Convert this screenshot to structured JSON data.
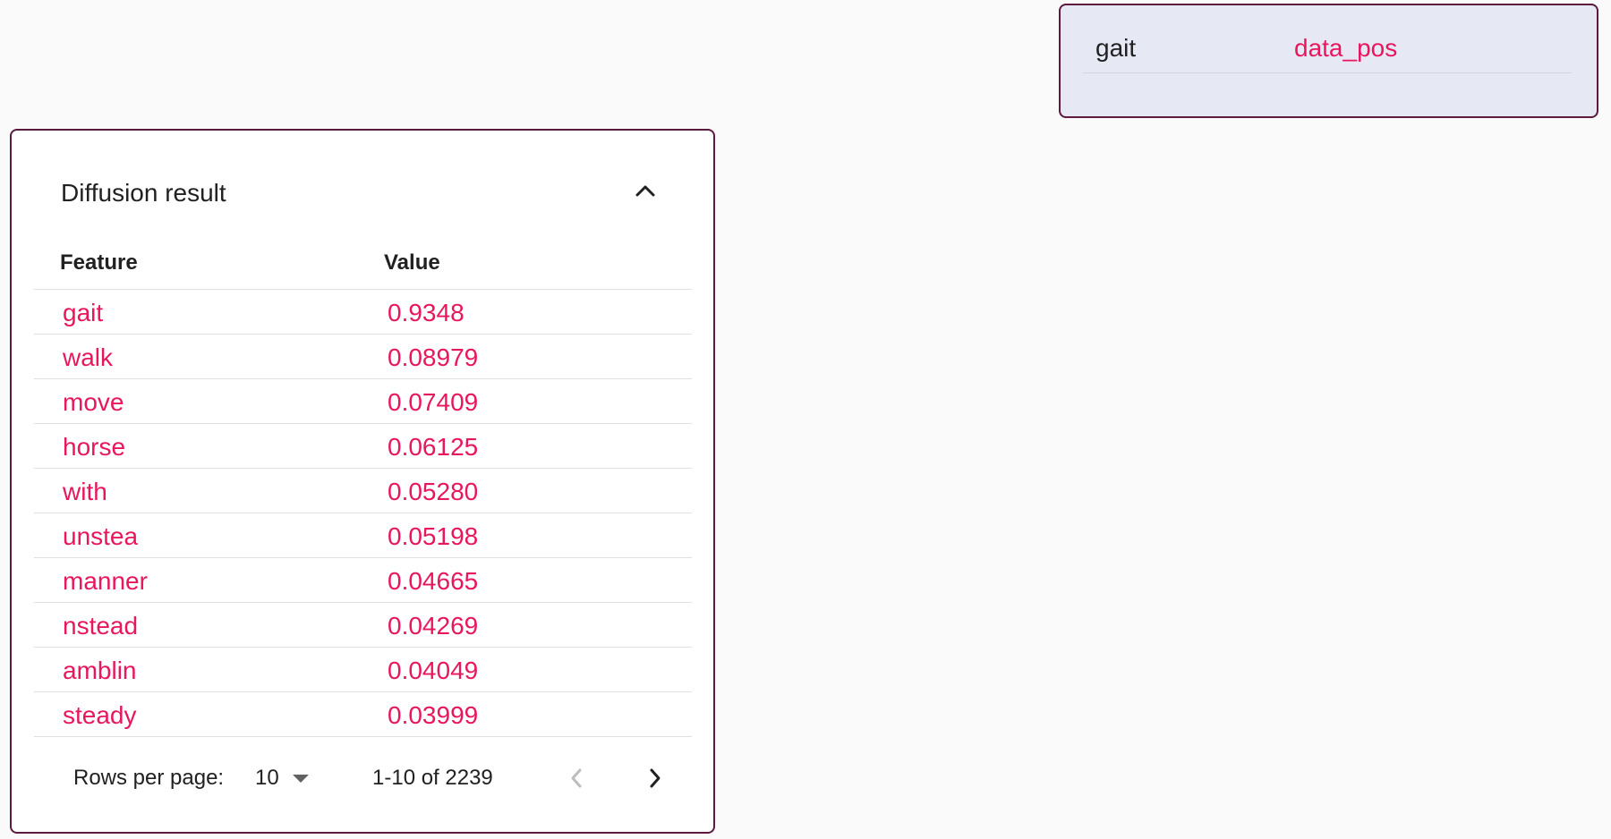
{
  "node_card": {
    "key": "gait",
    "value": "data_pos"
  },
  "panel": {
    "title": "Diffusion result",
    "collapse_icon": "chevron-up-icon",
    "columns": {
      "feature": "Feature",
      "value": "Value"
    },
    "rows": [
      {
        "feature": "gait",
        "value": "0.9348"
      },
      {
        "feature": "walk",
        "value": "0.08979"
      },
      {
        "feature": "move",
        "value": "0.07409"
      },
      {
        "feature": "horse",
        "value": "0.06125"
      },
      {
        "feature": "with",
        "value": "0.05280"
      },
      {
        "feature": "unstea",
        "value": "0.05198"
      },
      {
        "feature": "manner",
        "value": "0.04665"
      },
      {
        "feature": "nstead",
        "value": "0.04269"
      },
      {
        "feature": "amblin",
        "value": "0.04049"
      },
      {
        "feature": "steady",
        "value": "0.03999"
      }
    ],
    "pagination": {
      "rows_per_page_label": "Rows per page:",
      "rows_per_page_value": "10",
      "range_text": "1-10 of 2239",
      "prev_icon": "chevron-left-icon",
      "next_icon": "chevron-right-icon"
    }
  },
  "colors": {
    "accent": "#e8175d",
    "border": "#5c1a3f",
    "node_card_bg": "#e6e8f4"
  }
}
